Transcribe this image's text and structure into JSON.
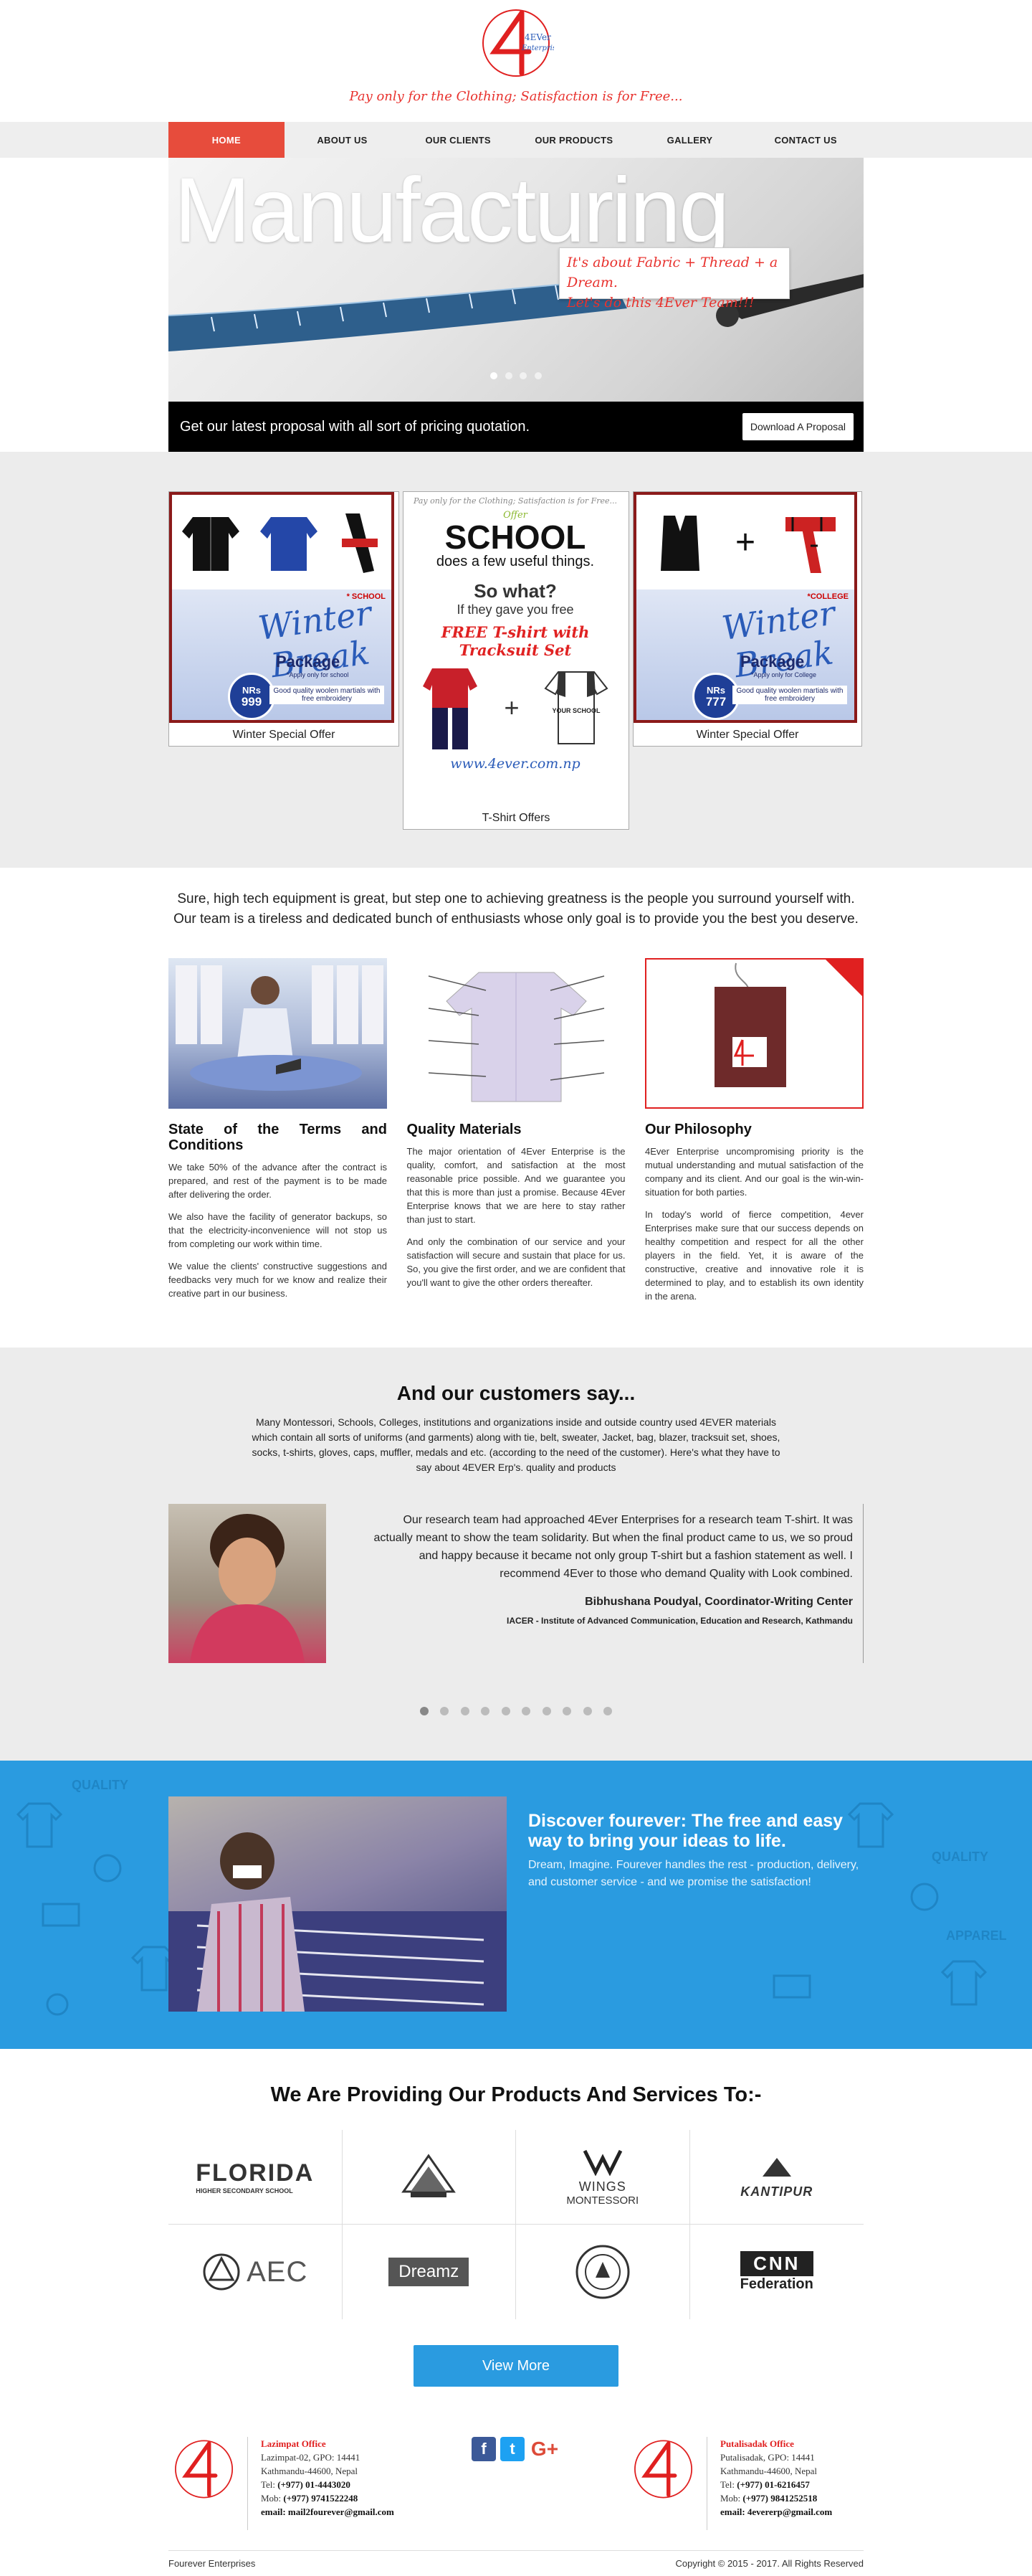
{
  "header": {
    "logo_text_top": "4EVer",
    "logo_text_bottom": "Enterprises",
    "tagline": "Pay only for the Clothing; Satisfaction is for Free..."
  },
  "nav": {
    "items": [
      "HOME",
      "ABOUT US",
      "OUR CLIENTS",
      "OUR PRODUCTS",
      "GALLERY",
      "CONTACT US"
    ],
    "active_index": 0
  },
  "hero": {
    "title": "Manufacturing",
    "callout_line1": "It's about Fabric + Thread + a Dream.",
    "callout_line2": "Let's do this 4Ever Team!!!",
    "slide_count": 4,
    "active_slide": 0,
    "bar_text": "Get our latest proposal with all sort of pricing quotation.",
    "button_label": "Download A Proposal"
  },
  "offers": {
    "left": {
      "label": "Winter Special Offer",
      "tag": "* SCHOOL",
      "title": "Winter Break",
      "package": "Package",
      "package_note": "*Apply only for school",
      "badge_top": "NRs",
      "badge_price": "999",
      "note": "Good quality woolen martials with free embroidery"
    },
    "center": {
      "label": "T-Shirt Offers",
      "top_line": "Pay only for the Clothing; Satisfaction is for Free...",
      "offer": "Offer",
      "big": "SCHOOL",
      "sub": "does a few useful things.",
      "what": "So what?",
      "if_line": "If they gave you free",
      "free_line": "FREE T-shirt with Tracksuit Set",
      "shirt_text": "YOUR SCHOOL",
      "www": "www.4ever.com.np"
    },
    "right": {
      "label": "Winter Special Offer",
      "tag": "*COLLEGE",
      "title": "Winter Break",
      "package": "Package",
      "package_note": "*Apply only for College",
      "badge_top": "NRs",
      "badge_price": "777",
      "note": "Good quality woolen martials with free embroidery"
    }
  },
  "intro": {
    "text": "Sure, high tech equipment is great, but step one to achieving greatness is the people you surround yourself with. Our team is a tireless and dedicated bunch of enthusiasts whose only goal is to provide you the best you deserve."
  },
  "columns": [
    {
      "title": "State of the Terms and Conditions",
      "paragraphs": [
        "We take 50% of the advance after the contract is prepared, and rest of the payment is to be made after delivering the order.",
        "We also have the facility of generator backups, so that the electricity-inconvenience will not stop us from completing our work within time.",
        "We value the clients' constructive suggestions and feedbacks very much for we know and realize their creative part in our business."
      ]
    },
    {
      "title": "Quality Materials",
      "paragraphs": [
        "The major orientation of 4Ever Enterprise is the quality, comfort, and satisfaction at the most reasonable price possible. And we guarantee you that this is more than just a promise. Because 4Ever Enterprise knows that we are here to stay rather than just to start.",
        "And only the combination of our service and your satisfaction will secure and sustain that place for us. So, you give the first order, and we are confident that you'll want to give the other orders thereafter."
      ]
    },
    {
      "title": "Our Philosophy",
      "paragraphs": [
        "4Ever Enterprise uncompromising priority is the mutual understanding and mutual satisfaction of the company and its client. And our goal is the win-win-situation for both parties.",
        "In today's world of fierce competition, 4ever Enterprises make sure that our success depends on healthy competition and respect for all the other players in the field. Yet, it is aware of the constructive, creative and innovative role it is determined to play, and to establish its own identity in the arena."
      ]
    }
  ],
  "testimonials": {
    "heading": "And our customers say...",
    "intro": "Many Montessori, Schools, Colleges, institutions and organizations inside and outside country used 4EVER materials which contain all sorts of uniforms (and garments) along with tie, belt, sweater, Jacket, bag, blazer, tracksuit set, shoes, socks, t-shirts, gloves, caps, muffler, medals and etc. (according to the need of the customer). Here's what they have to say about 4EVER Erp's. quality and products",
    "quote": "Our research team had approached 4Ever Enterprises for a research team T-shirt. It was actually meant to show the team solidarity. But when the final product came to us, we so proud and happy because it became not only group T-shirt but a fashion statement as well. I recommend 4Ever to those who demand Quality with Look combined.",
    "author": "Bibhushana Poudyal, Coordinator-Writing Center",
    "org": "IACER - Institute of Advanced Communication, Education and Research, Kathmandu",
    "dot_count": 10,
    "active_dot": 0
  },
  "discover": {
    "heading": "Discover fourever: The free and easy way to bring your ideas to life.",
    "text": "Dream, Imagine. Fourever handles the rest - production, delivery, and customer service - and we promise the satisfaction!",
    "pattern_words": [
      "QUALITY",
      "APPAREL"
    ]
  },
  "clients": {
    "heading": "We Are Providing Our Products And Services To:-",
    "logos": [
      {
        "name": "FLORIDA",
        "sub": "HIGHER SECONDARY SCHOOL"
      },
      {
        "name": "",
        "sub": ""
      },
      {
        "name": "WINGS",
        "sub": "MONTESSORI"
      },
      {
        "name": "KANTIPUR",
        "sub": ""
      },
      {
        "name": "AEC",
        "sub": ""
      },
      {
        "name": "Dreamz",
        "sub": ""
      },
      {
        "name": "",
        "sub": ""
      },
      {
        "name": "CNN",
        "sub": "Federation"
      }
    ],
    "button_label": "View More"
  },
  "footer": {
    "office1": {
      "title": "Lazimpat Office",
      "line1": "Lazimpat-02, GPO: 14441",
      "line2": "Kathmandu-44600, Nepal",
      "tel_label": "Tel:",
      "tel": "(+977) 01-4443020",
      "mob_label": "Mob:",
      "mob": "(+977) 9741522248",
      "email_label": "email:",
      "email": "mail2fourever@gmail.com"
    },
    "office2": {
      "title": "Putalisadak Office",
      "line1": "Putalisadak, GPO: 14441",
      "line2": "Kathmandu-44600, Nepal",
      "tel_label": "Tel:",
      "tel": "(+977) 01-6216457",
      "mob_label": "Mob:",
      "mob": "(+977) 9841252518",
      "email_label": "email:",
      "email": "4evererp@gmail.com"
    },
    "social": [
      "f",
      "t",
      "G+"
    ],
    "company": "Fourever Enterprises",
    "copyright": "Copyright © 2015 - 2017. All Rights Reserved"
  },
  "colors": {
    "accent_red": "#e74c3c",
    "brand_blue": "#2a9be0",
    "nav_bg": "#eeeeee",
    "section_gray": "#ececec"
  }
}
